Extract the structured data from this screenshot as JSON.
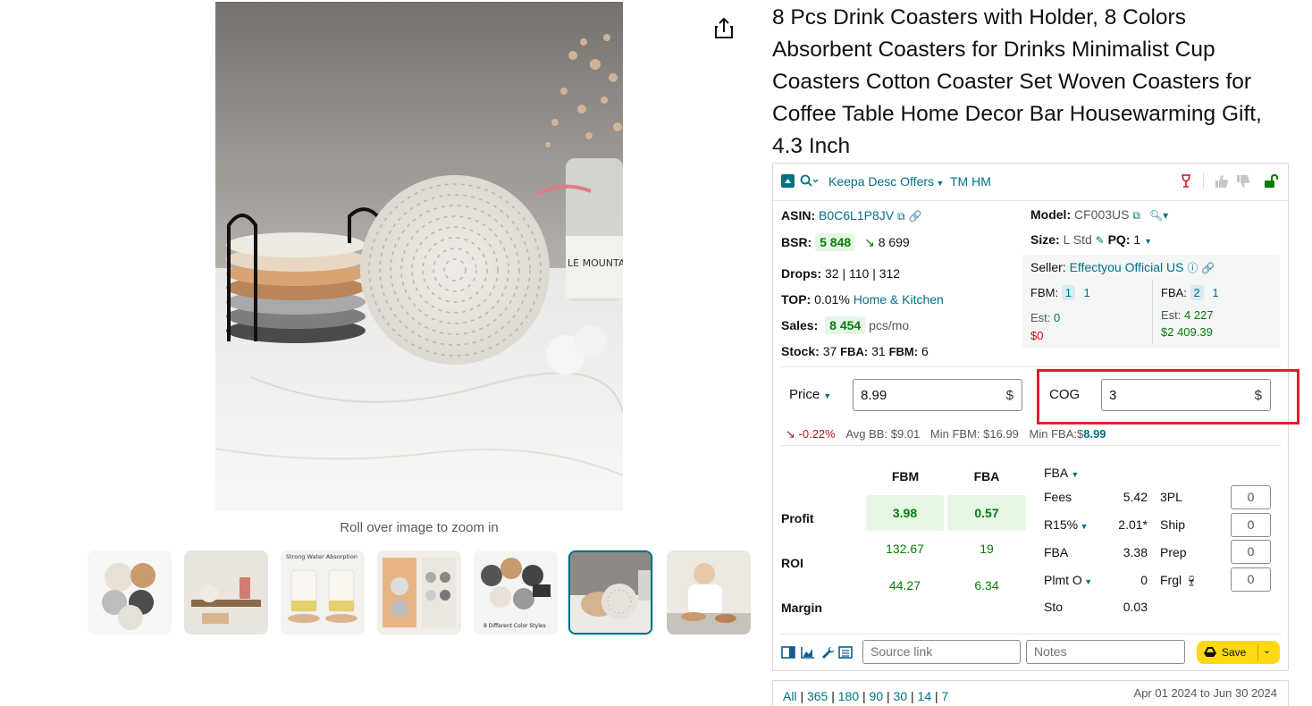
{
  "product": {
    "title": "8 Pcs Drink Coasters with Holder, 8 Colors Absorbent Coasters for Drinks Minimalist Cup Coasters Cotton Coaster Set Woven Coasters for Coffee Table Home Decor Bar Housewarming Gift, 4.3 Inch",
    "zoom_hint": "Roll over image to zoom in",
    "thumbnail_count": 7,
    "selected_thumbnail": 6,
    "image_caption_text": "LE MOUNTAIN",
    "thumb3_caption": "Strong Water Absorption",
    "thumb5_caption": "8 Different Color Styles"
  },
  "keepa": {
    "toolbar": {
      "offers_label": "Keepa Desc Offers",
      "tm_label": "TM HM"
    },
    "asin_label": "ASIN:",
    "asin_value": "B0C6L1P8JV",
    "model_label": "Model:",
    "model_value": "CF003US",
    "bsr_label": "BSR:",
    "bsr_value": "5 848",
    "bsr_avg": "8 699",
    "size_label": "Size:",
    "size_value": "L Std",
    "pq_label": "PQ:",
    "pq_value": "1",
    "drops_label": "Drops:",
    "drops_value": "32 | 110 | 312",
    "top_label": "TOP:",
    "top_value": "0.01%",
    "top_category": "Home & Kitchen",
    "sales_label": "Sales:",
    "sales_value": "8 454",
    "sales_unit": "pcs/mo",
    "stock_label": "Stock:",
    "stock_value": "37",
    "stock_fba_label": "FBA:",
    "stock_fba_value": "31",
    "stock_fbm_label": "FBM:",
    "stock_fbm_value": "6",
    "seller_label": "Seller:",
    "seller_name": "Effectyou Official US",
    "fbm_label": "FBM:",
    "fbm_count": "1",
    "fbm_count2": "1",
    "fba_label": "FBA:",
    "fba_count": "2",
    "fba_count2": "1",
    "est_label": "Est:",
    "fbm_est": "0",
    "fbm_est_money": "$0",
    "fba_est": "4 227",
    "fba_est_money": "$2 409.39",
    "price_label": "Price",
    "price_value": "8.99",
    "cog_label": "COG",
    "cog_value": "3",
    "currency": "$",
    "price_change": "-0.22%",
    "avg_bb_label": "Avg BB:",
    "avg_bb_value": "$9.01",
    "min_fbm_label": "Min FBM:",
    "min_fbm_value": "$16.99",
    "min_fba_label": "Min FBA:",
    "min_fba_prefix": "$",
    "min_fba_value": "8.99",
    "calc": {
      "col_fbm": "FBM",
      "col_fba": "FBA",
      "profit_label": "Profit",
      "roi_label": "ROI",
      "margin_label": "Margin",
      "profit_fbm": "3.98",
      "profit_fba": "0.57",
      "roi_fbm": "132.67",
      "roi_fba": "19",
      "margin_fbm": "44.27",
      "margin_fba": "6.34"
    },
    "fees": {
      "mode_label": "FBA",
      "rows": [
        {
          "label": "Fees",
          "value": "5.42"
        },
        {
          "label": "R15%",
          "value": "2.01*"
        },
        {
          "label": "FBA",
          "value": "3.38"
        },
        {
          "label": "Plmt O",
          "value": "0"
        },
        {
          "label": "Sto",
          "value": "0.03"
        }
      ],
      "extras": [
        {
          "label": "3PL",
          "value": "0"
        },
        {
          "label": "Ship",
          "value": "0"
        },
        {
          "label": "Prep",
          "value": "0"
        },
        {
          "label": "Frgl",
          "value": "0"
        }
      ]
    },
    "source_placeholder": "Source link",
    "notes_placeholder": "Notes",
    "save_label": "Save"
  },
  "range": {
    "links": [
      "All",
      "365",
      "180",
      "90",
      "30",
      "14",
      "7"
    ],
    "date_range": "Apr 01 2024 to Jun 30 2024"
  }
}
